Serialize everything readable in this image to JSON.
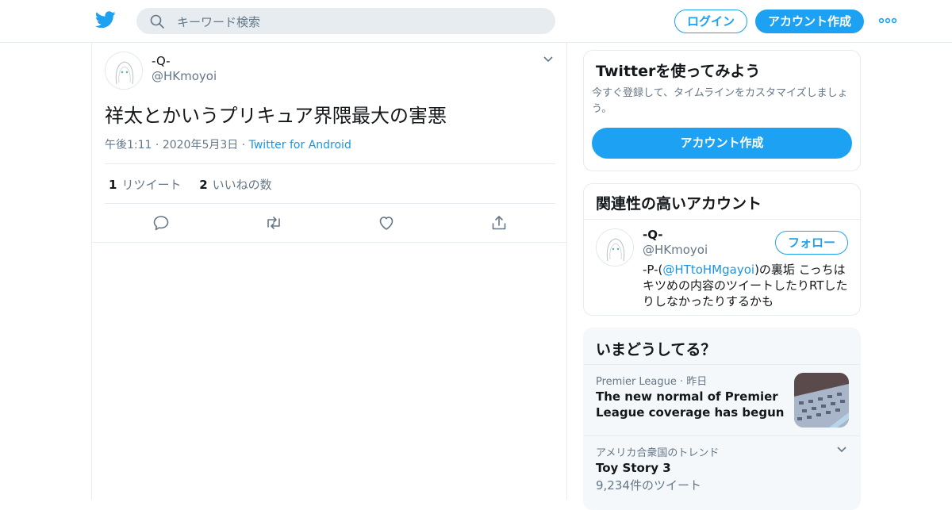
{
  "header": {
    "search_placeholder": "キーワード検索",
    "login_label": "ログイン",
    "signup_label": "アカウント作成"
  },
  "tweet": {
    "name": "-Q-",
    "handle": "@HKmoyoi",
    "text": "祥太とかいうプリキュア界隈最大の害悪",
    "time": "午後1:11",
    "date": "2020年5月3日",
    "source": "Twitter for Android",
    "retweet_count": "1",
    "retweet_label": "リツイート",
    "like_count": "2",
    "like_label": "いいねの数"
  },
  "signup_card": {
    "title": "Twitterを使ってみよう",
    "description": "今すぐ登録して、タイムラインをカスタマイズしましょう。",
    "button_label": "アカウント作成"
  },
  "related": {
    "title": "関連性の高いアカウント",
    "name": "-Q-",
    "handle": "@HKmoyoi",
    "follow_label": "フォロー",
    "bio_prefix": "-P-(",
    "bio_mention": "@HTtoHMgayoi",
    "bio_suffix": ")の裏垢 こっちはキツめの内容のツイートしたりRTしたりしなかったりするかも"
  },
  "trends": {
    "title": "いまどうしてる？",
    "items": [
      {
        "context": "Premier League · 昨日",
        "title": "The new normal of Premier League coverage has begun"
      },
      {
        "context": "アメリカ合衆国のトレンド",
        "title": "Toy Story 3",
        "count": "9,234件のツイート"
      }
    ]
  },
  "colors": {
    "accent": "#1da1f2",
    "link": "#1b95e0",
    "secondary_text": "#657786",
    "border": "#e6ecf0"
  }
}
